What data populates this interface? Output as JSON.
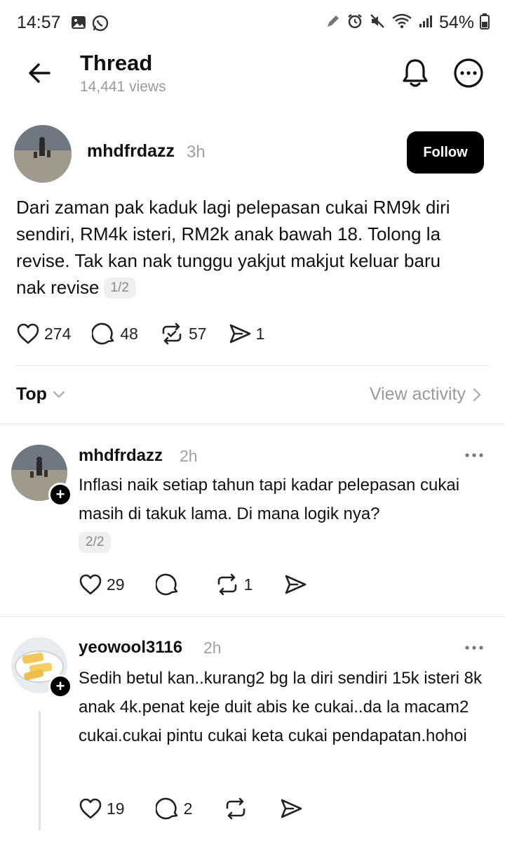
{
  "status_bar": {
    "time": "14:57",
    "battery": "54%",
    "left_icons": [
      "image-icon",
      "whatsapp-icon"
    ],
    "right_icons": [
      "pen-icon",
      "alarm-icon",
      "mute-icon",
      "wifi-icon",
      "signal-icon",
      "battery-icon"
    ]
  },
  "header": {
    "title": "Thread",
    "views": "14,441 views"
  },
  "post": {
    "author": "mhdfrdazz",
    "time": "3h",
    "follow_label": "Follow",
    "text": "Dari zaman pak kaduk lagi pelepasan cukai RM9k diri sendiri, RM4k isteri, RM2k anak bawah 18. Tolong la revise. Tak kan nak tunggu yakjut makjut keluar baru nak revise",
    "page_badge": "1/2",
    "likes": "274",
    "comments": "48",
    "reposts": "57",
    "shares": "1"
  },
  "sort": {
    "label": "Top",
    "view_activity": "View activity"
  },
  "replies": [
    {
      "author": "mhdfrdazz",
      "time": "2h",
      "text": "Inflasi naik setiap tahun tapi kadar pelepasan cukai masih di takuk lama. Di mana logik nya?",
      "page_badge": "2/2",
      "likes": "29",
      "comments": "",
      "reposts": "1",
      "shares": ""
    },
    {
      "author": "yeowool3116",
      "time": "2h",
      "text": "Sedih betul kan..kurang2 bg la diri sendiri 15k isteri 8k anak 4k.penat keje duit abis ke cukai..da la macam2 cukai.cukai pintu cukai keta cukai pendapatan.hohoi",
      "likes": "19",
      "comments": "2",
      "reposts": "",
      "shares": ""
    }
  ],
  "colors": {
    "text": "#111111",
    "muted": "#9a9a9a",
    "follow_bg": "#000000",
    "divider": "#e4e4e4"
  }
}
